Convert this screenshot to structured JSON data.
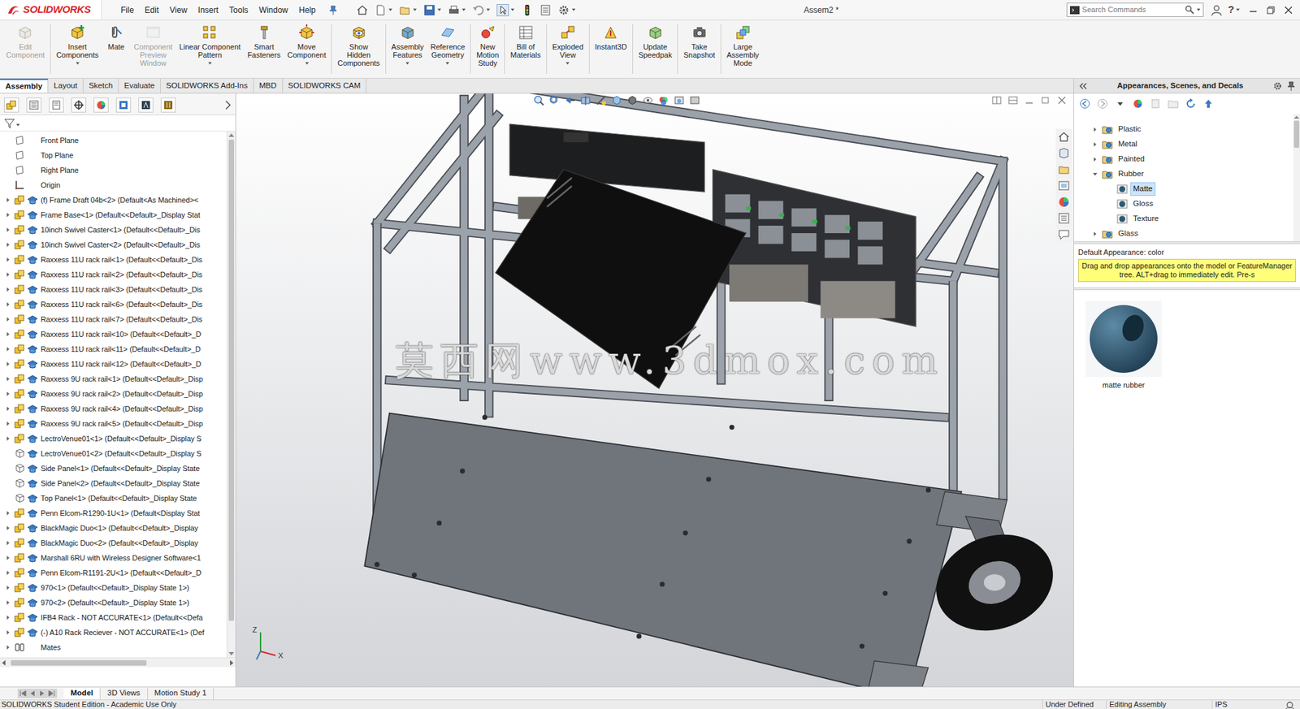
{
  "app": {
    "logo": "SOLIDWORKS",
    "title": "Assem2 *"
  },
  "menu": [
    "File",
    "Edit",
    "View",
    "Insert",
    "Tools",
    "Window",
    "Help"
  ],
  "search": {
    "placeholder": "Search Commands"
  },
  "help": "?",
  "ribbon": {
    "groups": [
      [
        {
          "label": "Edit\nComponent",
          "disabled": true,
          "dropdown": false
        }
      ],
      [
        {
          "label": "Insert\nComponents",
          "disabled": false,
          "dropdown": true
        },
        {
          "label": "Mate",
          "disabled": false,
          "dropdown": false
        },
        {
          "label": "Component\nPreview\nWindow",
          "disabled": true,
          "dropdown": false
        },
        {
          "label": "Linear Component\nPattern",
          "disabled": false,
          "dropdown": true
        },
        {
          "label": "Smart\nFasteners",
          "disabled": false,
          "dropdown": false
        },
        {
          "label": "Move\nComponent",
          "disabled": false,
          "dropdown": true
        }
      ],
      [
        {
          "label": "Show\nHidden\nComponents",
          "disabled": false,
          "dropdown": false
        }
      ],
      [
        {
          "label": "Assembly\nFeatures",
          "disabled": false,
          "dropdown": true
        },
        {
          "label": "Reference\nGeometry",
          "disabled": false,
          "dropdown": true
        }
      ],
      [
        {
          "label": "New\nMotion\nStudy",
          "disabled": false,
          "dropdown": false
        }
      ],
      [
        {
          "label": "Bill of\nMaterials",
          "disabled": false,
          "dropdown": false
        }
      ],
      [
        {
          "label": "Exploded\nView",
          "disabled": false,
          "dropdown": true
        }
      ],
      [
        {
          "label": "Instant3D",
          "disabled": false,
          "dropdown": false
        }
      ],
      [
        {
          "label": "Update\nSpeedpak",
          "disabled": false,
          "dropdown": false
        }
      ],
      [
        {
          "label": "Take\nSnapshot",
          "disabled": false,
          "dropdown": false
        }
      ],
      [
        {
          "label": "Large\nAssembly\nMode",
          "disabled": false,
          "dropdown": false
        }
      ]
    ]
  },
  "tabs": [
    {
      "label": "Assembly",
      "selected": true
    },
    {
      "label": "Layout",
      "selected": false
    },
    {
      "label": "Sketch",
      "selected": false
    },
    {
      "label": "Evaluate",
      "selected": false
    },
    {
      "label": "SOLIDWORKS Add-Ins",
      "selected": false
    },
    {
      "label": "MBD",
      "selected": false
    },
    {
      "label": "SOLIDWORKS CAM",
      "selected": false
    }
  ],
  "feature_tree": {
    "items": [
      {
        "label": "Front Plane",
        "kind": "plane",
        "selected": false
      },
      {
        "label": "Top Plane",
        "kind": "plane",
        "selected": false
      },
      {
        "label": "Right Plane",
        "kind": "plane",
        "selected": false
      },
      {
        "label": "Origin",
        "kind": "origin",
        "selected": false
      },
      {
        "label": "(f) Frame Draft 04b<2> (Default<As Machined><",
        "kind": "assembly",
        "expanded": false,
        "selected": false
      },
      {
        "label": "Frame Base<1> (Default<<Default>_Display Stat",
        "kind": "assembly",
        "expanded": false,
        "selected": false
      },
      {
        "label": "10inch Swivel Caster<1> (Default<<Default>_Dis",
        "kind": "assembly",
        "expanded": false,
        "selected": false
      },
      {
        "label": "10inch Swivel Caster<2> (Default<<Default>_Dis",
        "kind": "assembly",
        "expanded": false,
        "selected": false
      },
      {
        "label": "Raxxess 11U rack rail<1> (Default<<Default>_Dis",
        "kind": "assembly",
        "expanded": false,
        "selected": false
      },
      {
        "label": "Raxxess 11U rack rail<2> (Default<<Default>_Dis",
        "kind": "assembly",
        "expanded": false,
        "selected": false
      },
      {
        "label": "Raxxess 11U rack rail<3> (Default<<Default>_Dis",
        "kind": "assembly",
        "expanded": false,
        "selected": false
      },
      {
        "label": "Raxxess 11U rack rail<6> (Default<<Default>_Dis",
        "kind": "assembly",
        "expanded": false,
        "selected": false
      },
      {
        "label": "Raxxess 11U rack rail<7> (Default<<Default>_Dis",
        "kind": "assembly",
        "expanded": false,
        "selected": false
      },
      {
        "label": "Raxxess 11U rack rail<10> (Default<<Default>_D",
        "kind": "assembly",
        "expanded": false,
        "selected": false
      },
      {
        "label": "Raxxess 11U rack rail<11> (Default<<Default>_D",
        "kind": "assembly",
        "expanded": false,
        "selected": false
      },
      {
        "label": "Raxxess 11U rack rail<12> (Default<<Default>_D",
        "kind": "assembly",
        "expanded": false,
        "selected": false
      },
      {
        "label": "Raxxess 9U rack rail<1> (Default<<Default>_Disp",
        "kind": "assembly",
        "expanded": false,
        "selected": false
      },
      {
        "label": "Raxxess 9U rack rail<2> (Default<<Default>_Disp",
        "kind": "assembly",
        "expanded": false,
        "selected": false
      },
      {
        "label": "Raxxess 9U rack rail<4> (Default<<Default>_Disp",
        "kind": "assembly",
        "expanded": false,
        "selected": false
      },
      {
        "label": "Raxxess 9U rack rail<5> (Default<<Default>_Disp",
        "kind": "assembly",
        "expanded": false,
        "selected": false
      },
      {
        "label": "LectroVenue01<1> (Default<<Default>_Display S",
        "kind": "assembly",
        "expanded": false,
        "selected": false
      },
      {
        "label": "LectroVenue01<2> (Default<<Default>_Display S",
        "kind": "part",
        "selected": false
      },
      {
        "label": "Side Panel<1> (Default<<Default>_Display State",
        "kind": "part",
        "selected": false
      },
      {
        "label": "Side Panel<2> (Default<<Default>_Display State",
        "kind": "part",
        "selected": false
      },
      {
        "label": "Top Panel<1> (Default<<Default>_Display State",
        "kind": "part",
        "selected": false
      },
      {
        "label": "Penn Elcom-R1290-1U<1> (Default<Display Stat",
        "kind": "assembly",
        "expanded": false,
        "selected": false
      },
      {
        "label": "BlackMagic Duo<1> (Default<<Default>_Display",
        "kind": "assembly",
        "expanded": false,
        "selected": false
      },
      {
        "label": "BlackMagic Duo<2> (Default<<Default>_Display",
        "kind": "assembly",
        "expanded": false,
        "selected": false
      },
      {
        "label": "Marshall 6RU with Wireless Designer Software<1",
        "kind": "assembly",
        "expanded": false,
        "selected": false
      },
      {
        "label": "Penn Elcom-R1191-2U<1> (Default<<Default>_D",
        "kind": "assembly",
        "expanded": false,
        "selected": false
      },
      {
        "label": "970<1> (Default<<Default>_Display State 1>)",
        "kind": "assembly",
        "expanded": false,
        "selected": false
      },
      {
        "label": "970<2> (Default<<Default>_Display State 1>)",
        "kind": "assembly",
        "expanded": false,
        "selected": false
      },
      {
        "label": "IFB4 Rack - NOT ACCURATE<1> (Default<<Defa",
        "kind": "assembly",
        "expanded": false,
        "selected": false
      },
      {
        "label": "(-) A10 Rack Reciever - NOT ACCURATE<1> (Def",
        "kind": "assembly",
        "expanded": false,
        "selected": false
      },
      {
        "label": "Mates",
        "kind": "mates",
        "expanded": false,
        "selected": false
      }
    ]
  },
  "viewport": {
    "watermark": "莫西网www.3dmox.com",
    "triad": {
      "z": "Z",
      "x": "X"
    }
  },
  "task_pane": {
    "title": "Appearances, Scenes, and Decals",
    "tree": [
      {
        "label": "Plastic",
        "kind": "folder",
        "expanded": false,
        "selected": false
      },
      {
        "label": "Metal",
        "kind": "folder",
        "expanded": false,
        "selected": false
      },
      {
        "label": "Painted",
        "kind": "folder",
        "expanded": false,
        "selected": false
      },
      {
        "label": "Rubber",
        "kind": "folder",
        "expanded": true,
        "selected": false
      },
      {
        "label": "Matte",
        "kind": "child",
        "selected": true
      },
      {
        "label": "Gloss",
        "kind": "child",
        "selected": false
      },
      {
        "label": "Texture",
        "kind": "child",
        "selected": false
      },
      {
        "label": "Glass",
        "kind": "folder",
        "expanded": false,
        "selected": false
      }
    ],
    "default_appearance": "Default Appearance: color",
    "tip": "Drag and drop appearances onto the model or FeatureManager tree.  ALT+drag to immediately edit.  Pre-s",
    "thumbnail": {
      "label": "matte rubber",
      "selected": false
    }
  },
  "bottom_tabs": [
    {
      "label": "Model",
      "selected": true
    },
    {
      "label": "3D Views",
      "selected": false
    },
    {
      "label": "Motion Study 1",
      "selected": false
    }
  ],
  "status_bar": {
    "left": "SOLIDWORKS Student Edition - Academic Use Only",
    "items": [
      "Under Defined",
      "Editing Assembly",
      "IPS"
    ]
  }
}
